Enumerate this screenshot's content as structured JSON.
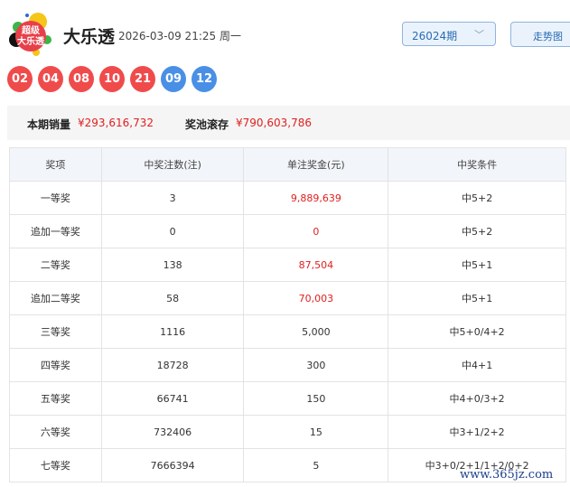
{
  "header": {
    "logo_text": "超级大乐透",
    "title": "大乐透",
    "datetime": "2026-03-09 21:25 周一",
    "period": "26024期",
    "trend_button": "走势图"
  },
  "balls": {
    "front": [
      "02",
      "04",
      "08",
      "10",
      "21"
    ],
    "back": [
      "09",
      "12"
    ],
    "colors": {
      "front": "#f04b4b",
      "back": "#4a8fe6"
    }
  },
  "summary": {
    "sales_label": "本期销量",
    "sales": "¥293,616,732",
    "pool_label": "奖池滚存",
    "pool": "¥790,603,786"
  },
  "table": {
    "headers": [
      "奖项",
      "中奖注数(注)",
      "单注奖金(元)",
      "中奖条件"
    ],
    "rows": [
      [
        "一等奖",
        "3",
        "9,889,639",
        "中5+2"
      ],
      [
        "追加一等奖",
        "0",
        "0",
        "中5+2"
      ],
      [
        "二等奖",
        "138",
        "87,504",
        "中5+1"
      ],
      [
        "追加二等奖",
        "58",
        "70,003",
        "中5+1"
      ],
      [
        "三等奖",
        "1116",
        "5,000",
        "中5+0/4+2"
      ],
      [
        "四等奖",
        "18728",
        "300",
        "中4+1"
      ],
      [
        "五等奖",
        "66741",
        "150",
        "中4+0/3+2"
      ],
      [
        "六等奖",
        "732406",
        "15",
        "中3+1/2+2"
      ],
      [
        "七等奖",
        "7666394",
        "5",
        "中3+0/2+1/1+2/0+2"
      ]
    ]
  },
  "watermark": "www.365jz.com"
}
